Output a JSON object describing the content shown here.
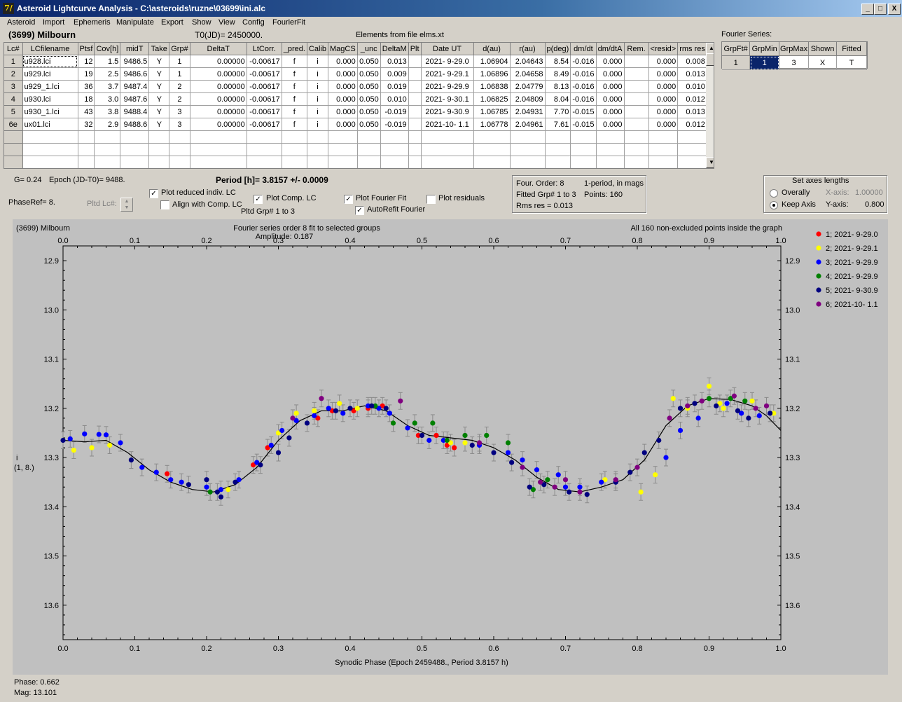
{
  "window": {
    "title": "Asteroid Lightcurve Analysis - C:\\asteroids\\ruzne\\03699\\ini.alc",
    "icon": "app-logo-icon",
    "btn_min": "_",
    "btn_max": "□",
    "btn_close": "X"
  },
  "menu": [
    "Asteroid",
    "Import",
    "Ephemeris",
    "Manipulate",
    "Export",
    "Show",
    "View",
    "Config",
    "FourierFit"
  ],
  "header": {
    "asteroid": "(3699) Milbourn",
    "t0": "T0(JD)= 2450000.",
    "elements": "Elements from file elms.xt",
    "fourier_label": "Fourier Series:"
  },
  "table": {
    "columns": [
      "Lc#",
      "LCfilename",
      "Ptsf",
      "Cov[h]",
      "midT",
      "Take",
      "Grp#",
      "DeltaT",
      "LtCorr.",
      "_pred.",
      "Calib",
      "MagCS",
      "_unc",
      "DeltaM",
      "Plt",
      "Date UT",
      "d(au)",
      "r(au)",
      "p(deg)",
      "dm/dt",
      "dm/dtA",
      "Rem.",
      "<resid>",
      "rms res"
    ],
    "rows": [
      [
        "1",
        "u928.lci",
        "12",
        "1.5",
        "9486.5",
        "Y",
        "1",
        "0.00000",
        "-0.00617",
        "f",
        "i",
        "0.000",
        "0.050",
        "0.013",
        "",
        "2021- 9-29.0",
        "1.06904",
        "2.04643",
        "8.54",
        "-0.016",
        "0.000",
        "",
        "0.000",
        "0.008"
      ],
      [
        "2",
        "u929.lci",
        "19",
        "2.5",
        "9486.6",
        "Y",
        "1",
        "0.00000",
        "-0.00617",
        "f",
        "i",
        "0.000",
        "0.050",
        "0.009",
        "",
        "2021- 9-29.1",
        "1.06896",
        "2.04658",
        "8.49",
        "-0.016",
        "0.000",
        "",
        "0.000",
        "0.013"
      ],
      [
        "3",
        "u929_1.lci",
        "36",
        "3.7",
        "9487.4",
        "Y",
        "2",
        "0.00000",
        "-0.00617",
        "f",
        "i",
        "0.000",
        "0.050",
        "0.019",
        "",
        "2021- 9-29.9",
        "1.06838",
        "2.04779",
        "8.13",
        "-0.016",
        "0.000",
        "",
        "0.000",
        "0.010"
      ],
      [
        "4",
        "u930.lci",
        "18",
        "3.0",
        "9487.6",
        "Y",
        "2",
        "0.00000",
        "-0.00617",
        "f",
        "i",
        "0.000",
        "0.050",
        "0.010",
        "",
        "2021- 9-30.1",
        "1.06825",
        "2.04809",
        "8.04",
        "-0.016",
        "0.000",
        "",
        "0.000",
        "0.012"
      ],
      [
        "5",
        "u930_1.lci",
        "43",
        "3.8",
        "9488.4",
        "Y",
        "3",
        "0.00000",
        "-0.00617",
        "f",
        "i",
        "0.000",
        "0.050",
        "-0.019",
        "",
        "2021- 9-30.9",
        "1.06785",
        "2.04931",
        "7.70",
        "-0.015",
        "0.000",
        "",
        "0.000",
        "0.013"
      ],
      [
        "6e",
        "ux01.lci",
        "32",
        "2.9",
        "9488.6",
        "Y",
        "3",
        "0.00000",
        "-0.00617",
        "f",
        "i",
        "0.000",
        "0.050",
        "-0.019",
        "",
        "2021-10- 1.1",
        "1.06778",
        "2.04961",
        "7.61",
        "-0.015",
        "0.000",
        "",
        "0.000",
        "0.012"
      ]
    ]
  },
  "fourier_table": {
    "columns": [
      "GrpFt#",
      "GrpMin",
      "GrpMax",
      "Shown",
      "Fitted"
    ],
    "row": [
      "1",
      "1",
      "3",
      "X",
      "T"
    ]
  },
  "controls": {
    "g_label": "G= 0.24",
    "epoch": "Epoch (JD-T0)= 9488.",
    "period": "Period [h]= 3.8157 +/- 0.0009",
    "phaseref": "PhaseRef= 8.",
    "pltd_lc": "Pltd Lc#:",
    "plot_reduced": "Plot reduced indiv. LC",
    "align_comp": "Align with Comp. LC",
    "plot_comp": "Plot Comp. LC",
    "pltd_grp": "Pltd Grp#  1   to   3",
    "plot_fourier": "Plot Fourier Fit",
    "autorefit": "AutoRefit Fourier",
    "plot_residuals": "Plot residuals",
    "check_mark": "✓"
  },
  "fit_info": {
    "order": "Four. Order:  8",
    "mode": "1-period, in mags",
    "fitted": "Fitted Grp# 1 to 3",
    "points": "Points: 160",
    "rms": "Rms res     = 0.013"
  },
  "axes_box": {
    "title": "Set axes lengths",
    "overally": "Overally",
    "keep": "Keep Axis",
    "xaxis_label": "X-axis:",
    "xaxis_val": "1.00000",
    "yaxis_label": "Y-axis:",
    "yaxis_val": "0.800"
  },
  "plot": {
    "name": "(3699) Milbourn",
    "title": "Fourier series order 8 fit to selected groups",
    "amplitude": "Amplitude: 0.187",
    "points_note": "All 160 non-excluded points inside the graph",
    "ylabel": "i",
    "ylabel2": "(1, 8.)",
    "xlabel": "Synodic Phase (Epoch 2459488., Period 3.8157 h)"
  },
  "status": {
    "phase": "Phase:  0.662",
    "mag": "Mag:    13.101"
  },
  "chart_data": {
    "type": "scatter",
    "title": "Fourier series order 8 fit to selected groups",
    "xlabel": "Synodic Phase (Epoch 2459488., Period 3.8157 h)",
    "ylabel": "i",
    "xlim": [
      0,
      1
    ],
    "ylim": [
      13.67,
      12.87
    ],
    "y_inverted": true,
    "x_ticks": [
      "0.0",
      "0.1",
      "0.2",
      "0.3",
      "0.4",
      "0.5",
      "0.6",
      "0.7",
      "0.8",
      "0.9",
      "1.0"
    ],
    "y_ticks": [
      "12.9",
      "13.0",
      "13.1",
      "13.2",
      "13.3",
      "13.4",
      "13.5",
      "13.6"
    ],
    "legend_position": "right",
    "series": [
      {
        "name": "1; 2021- 9-29.0",
        "color": "#ff0000",
        "points": [
          [
            0.145,
            13.333
          ],
          [
            0.265,
            13.315
          ],
          [
            0.285,
            13.28
          ],
          [
            0.355,
            13.22
          ],
          [
            0.375,
            13.205
          ],
          [
            0.405,
            13.205
          ],
          [
            0.425,
            13.2
          ],
          [
            0.445,
            13.195
          ],
          [
            0.495,
            13.255
          ],
          [
            0.52,
            13.255
          ],
          [
            0.535,
            13.275
          ],
          [
            0.545,
            13.28
          ]
        ]
      },
      {
        "name": "2; 2021- 9-29.1",
        "color": "#ffff00",
        "points": [
          [
            0.015,
            13.285
          ],
          [
            0.04,
            13.28
          ],
          [
            0.065,
            13.275
          ],
          [
            0.23,
            13.365
          ],
          [
            0.3,
            13.25
          ],
          [
            0.325,
            13.21
          ],
          [
            0.35,
            13.205
          ],
          [
            0.385,
            13.19
          ],
          [
            0.41,
            13.2
          ],
          [
            0.54,
            13.27
          ],
          [
            0.56,
            13.27
          ],
          [
            0.755,
            13.345
          ],
          [
            0.805,
            13.37
          ],
          [
            0.825,
            13.335
          ],
          [
            0.85,
            13.18
          ],
          [
            0.87,
            13.2
          ],
          [
            0.9,
            13.155
          ],
          [
            0.915,
            13.19
          ],
          [
            0.92,
            13.2
          ],
          [
            0.96,
            13.185
          ],
          [
            0.99,
            13.21
          ]
        ]
      },
      {
        "name": "3; 2021- 9-29.9",
        "color": "#0000ff",
        "points": [
          [
            0.01,
            13.262
          ],
          [
            0.03,
            13.252
          ],
          [
            0.05,
            13.253
          ],
          [
            0.06,
            13.254
          ],
          [
            0.08,
            13.27
          ],
          [
            0.11,
            13.32
          ],
          [
            0.13,
            13.33
          ],
          [
            0.15,
            13.345
          ],
          [
            0.165,
            13.35
          ],
          [
            0.2,
            13.36
          ],
          [
            0.22,
            13.365
          ],
          [
            0.245,
            13.345
          ],
          [
            0.27,
            13.31
          ],
          [
            0.29,
            13.275
          ],
          [
            0.305,
            13.245
          ],
          [
            0.325,
            13.225
          ],
          [
            0.35,
            13.215
          ],
          [
            0.37,
            13.2
          ],
          [
            0.39,
            13.21
          ],
          [
            0.425,
            13.195
          ],
          [
            0.44,
            13.2
          ],
          [
            0.455,
            13.21
          ],
          [
            0.48,
            13.24
          ],
          [
            0.51,
            13.265
          ],
          [
            0.53,
            13.265
          ],
          [
            0.58,
            13.275
          ],
          [
            0.62,
            13.29
          ],
          [
            0.64,
            13.305
          ],
          [
            0.66,
            13.325
          ],
          [
            0.69,
            13.335
          ],
          [
            0.7,
            13.36
          ],
          [
            0.72,
            13.36
          ],
          [
            0.75,
            13.35
          ],
          [
            0.77,
            13.35
          ],
          [
            0.84,
            13.3
          ],
          [
            0.86,
            13.245
          ],
          [
            0.885,
            13.22
          ],
          [
            0.925,
            13.19
          ],
          [
            0.945,
            13.21
          ],
          [
            0.97,
            13.215
          ]
        ]
      },
      {
        "name": "4; 2021- 9-29.9",
        "color": "#008000",
        "points": [
          [
            0.205,
            13.37
          ],
          [
            0.435,
            13.195
          ],
          [
            0.46,
            13.23
          ],
          [
            0.49,
            13.23
          ],
          [
            0.515,
            13.23
          ],
          [
            0.535,
            13.265
          ],
          [
            0.56,
            13.255
          ],
          [
            0.59,
            13.255
          ],
          [
            0.62,
            13.27
          ],
          [
            0.655,
            13.365
          ],
          [
            0.675,
            13.345
          ],
          [
            0.9,
            13.18
          ],
          [
            0.93,
            13.18
          ],
          [
            0.95,
            13.185
          ]
        ]
      },
      {
        "name": "5; 2021- 9-30.9",
        "color": "#000080",
        "points": [
          [
            0.0,
            13.265
          ],
          [
            0.095,
            13.305
          ],
          [
            0.175,
            13.355
          ],
          [
            0.2,
            13.345
          ],
          [
            0.215,
            13.37
          ],
          [
            0.22,
            13.38
          ],
          [
            0.24,
            13.35
          ],
          [
            0.275,
            13.315
          ],
          [
            0.3,
            13.29
          ],
          [
            0.315,
            13.26
          ],
          [
            0.34,
            13.23
          ],
          [
            0.38,
            13.205
          ],
          [
            0.4,
            13.2
          ],
          [
            0.43,
            13.195
          ],
          [
            0.45,
            13.2
          ],
          [
            0.5,
            13.255
          ],
          [
            0.57,
            13.275
          ],
          [
            0.6,
            13.29
          ],
          [
            0.625,
            13.31
          ],
          [
            0.65,
            13.36
          ],
          [
            0.67,
            13.355
          ],
          [
            0.705,
            13.37
          ],
          [
            0.73,
            13.375
          ],
          [
            0.77,
            13.35
          ],
          [
            0.79,
            13.33
          ],
          [
            0.81,
            13.29
          ],
          [
            0.83,
            13.265
          ],
          [
            0.86,
            13.2
          ],
          [
            0.88,
            13.19
          ],
          [
            0.91,
            13.195
          ],
          [
            0.94,
            13.205
          ],
          [
            0.955,
            13.22
          ],
          [
            0.985,
            13.21
          ]
        ]
      },
      {
        "name": "6; 2021-10- 1.1",
        "color": "#800080",
        "points": [
          [
            0.32,
            13.22
          ],
          [
            0.36,
            13.18
          ],
          [
            0.47,
            13.185
          ],
          [
            0.58,
            13.27
          ],
          [
            0.64,
            13.32
          ],
          [
            0.665,
            13.35
          ],
          [
            0.685,
            13.36
          ],
          [
            0.7,
            13.345
          ],
          [
            0.72,
            13.37
          ],
          [
            0.77,
            13.345
          ],
          [
            0.8,
            13.32
          ],
          [
            0.845,
            13.22
          ],
          [
            0.87,
            13.195
          ],
          [
            0.89,
            13.185
          ],
          [
            0.935,
            13.175
          ],
          [
            0.965,
            13.2
          ],
          [
            0.98,
            13.195
          ]
        ]
      }
    ],
    "fit_curve": [
      [
        0.0,
        13.265
      ],
      [
        0.03,
        13.268
      ],
      [
        0.06,
        13.265
      ],
      [
        0.09,
        13.29
      ],
      [
        0.12,
        13.325
      ],
      [
        0.15,
        13.35
      ],
      [
        0.18,
        13.365
      ],
      [
        0.21,
        13.37
      ],
      [
        0.24,
        13.355
      ],
      [
        0.27,
        13.32
      ],
      [
        0.3,
        13.265
      ],
      [
        0.33,
        13.225
      ],
      [
        0.36,
        13.205
      ],
      [
        0.39,
        13.205
      ],
      [
        0.42,
        13.195
      ],
      [
        0.45,
        13.205
      ],
      [
        0.48,
        13.235
      ],
      [
        0.51,
        13.255
      ],
      [
        0.54,
        13.26
      ],
      [
        0.57,
        13.265
      ],
      [
        0.6,
        13.28
      ],
      [
        0.63,
        13.305
      ],
      [
        0.66,
        13.34
      ],
      [
        0.69,
        13.365
      ],
      [
        0.72,
        13.37
      ],
      [
        0.75,
        13.36
      ],
      [
        0.78,
        13.345
      ],
      [
        0.81,
        13.305
      ],
      [
        0.84,
        13.235
      ],
      [
        0.87,
        13.195
      ],
      [
        0.9,
        13.18
      ],
      [
        0.93,
        13.182
      ],
      [
        0.96,
        13.195
      ],
      [
        0.98,
        13.215
      ],
      [
        1.0,
        13.245
      ]
    ]
  }
}
